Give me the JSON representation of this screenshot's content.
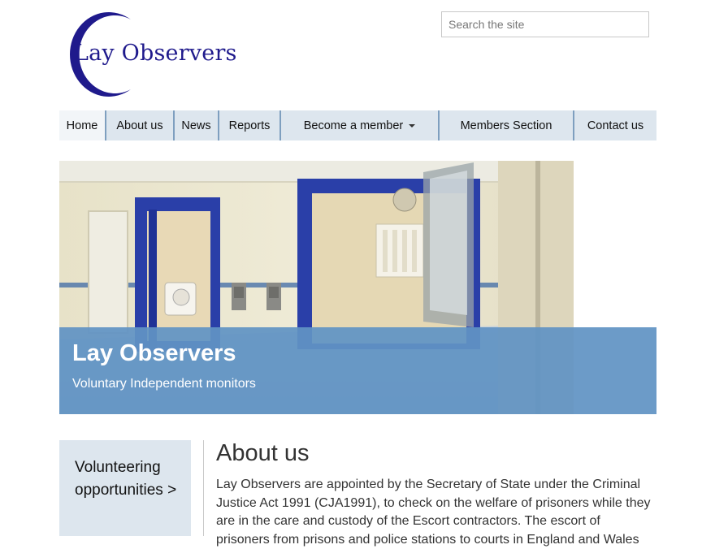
{
  "logo": {
    "text": "Lay Observers"
  },
  "search": {
    "placeholder": "Search the site"
  },
  "nav": {
    "items": [
      {
        "label": "Home"
      },
      {
        "label": "About us"
      },
      {
        "label": "News"
      },
      {
        "label": "Reports"
      },
      {
        "label": "Become a member"
      },
      {
        "label": "Members Section"
      },
      {
        "label": "Contact us"
      }
    ]
  },
  "hero": {
    "title": "Lay Observers",
    "subtitle": "Voluntary Independent monitors"
  },
  "sidebar": {
    "link_text": "Volunteering opportunities >"
  },
  "content": {
    "title": "About us",
    "body": "Lay Observers are appointed by the Secretary of State under the Criminal Justice Act 1991 (CJA1991), to check on the welfare of prisoners while they are in the care and custody of the Escort contractors. The escort of prisoners from prisons and police stations to courts in England and Wales"
  },
  "colors": {
    "brand": "#1f1a8c",
    "nav_bg": "#dde6ee",
    "nav_divider": "#7e9fbf",
    "banner": "#6193c4"
  }
}
